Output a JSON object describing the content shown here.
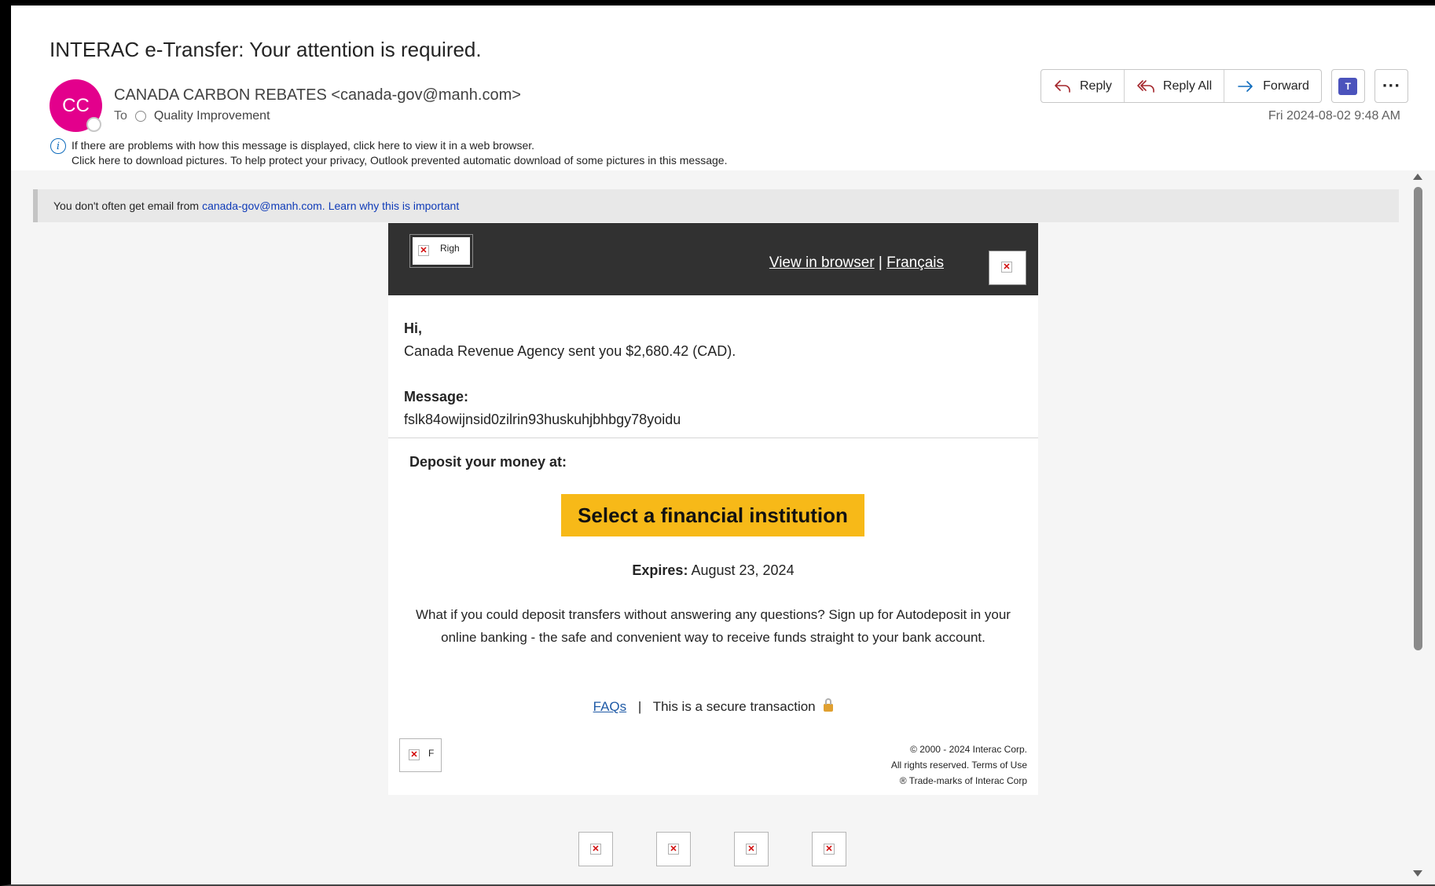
{
  "message": {
    "subject": "INTERAC e-Transfer: Your attention is required.",
    "avatar_initials": "CC",
    "sender": "CANADA CARBON REBATES <canada-gov@manh.com>",
    "to_label": "To",
    "recipient": "Quality Improvement",
    "datetime": "Fri 2024-08-02 9:48 AM",
    "info_line_1": "If there are problems with how this message is displayed, click here to view it in a web browser.",
    "info_line_2": "Click here to download pictures. To help protect your privacy, Outlook prevented automatic download of some pictures in this message."
  },
  "toolbar": {
    "reply": "Reply",
    "reply_all": "Reply All",
    "forward": "Forward",
    "teams_icon": "teams-icon",
    "more_icon": "more-icon",
    "teams_letter": "T",
    "more_glyph": "···"
  },
  "notice": {
    "prefix": "You don't often get email from",
    "sender_link": "canada-gov@manh.com.",
    "learn_link": "Learn why this is important"
  },
  "email": {
    "logo_alt": "Righ",
    "view_in_browser": "View in browser",
    "separator": "|",
    "francais": "Français",
    "greeting": "Hi,",
    "sent_line": "Canada Revenue Agency sent you $2,680.42 (CAD).",
    "message_label": "Message:",
    "message_value": "fslk84owijnsid0zilrin93huskuhjbhbgy78yoidu",
    "deposit_label": "Deposit your money at:",
    "cta": "Select a financial institution",
    "expires_label": "Expires:",
    "expires_date": "August 23, 2024",
    "autodeposit_text": "What if you could deposit transfers without answering any questions? Sign up for Autodeposit in your online banking - the safe and convenient way to receive funds straight to your bank account.",
    "faqs": "FAQs",
    "faq_separator": "|",
    "secure_text": "This is a secure transaction",
    "footer_alt": "F",
    "copyright_1": "© 2000 - 2024 Interac Corp.",
    "copyright_2": "All rights reserved. Terms of Use",
    "copyright_3": "® Trade-marks of Interac Corp"
  },
  "broken_image_glyph": "✕",
  "colors": {
    "avatar": "#e3008c",
    "cta": "#f7b918",
    "header_bar": "#313131",
    "link": "#0f3bb8"
  }
}
